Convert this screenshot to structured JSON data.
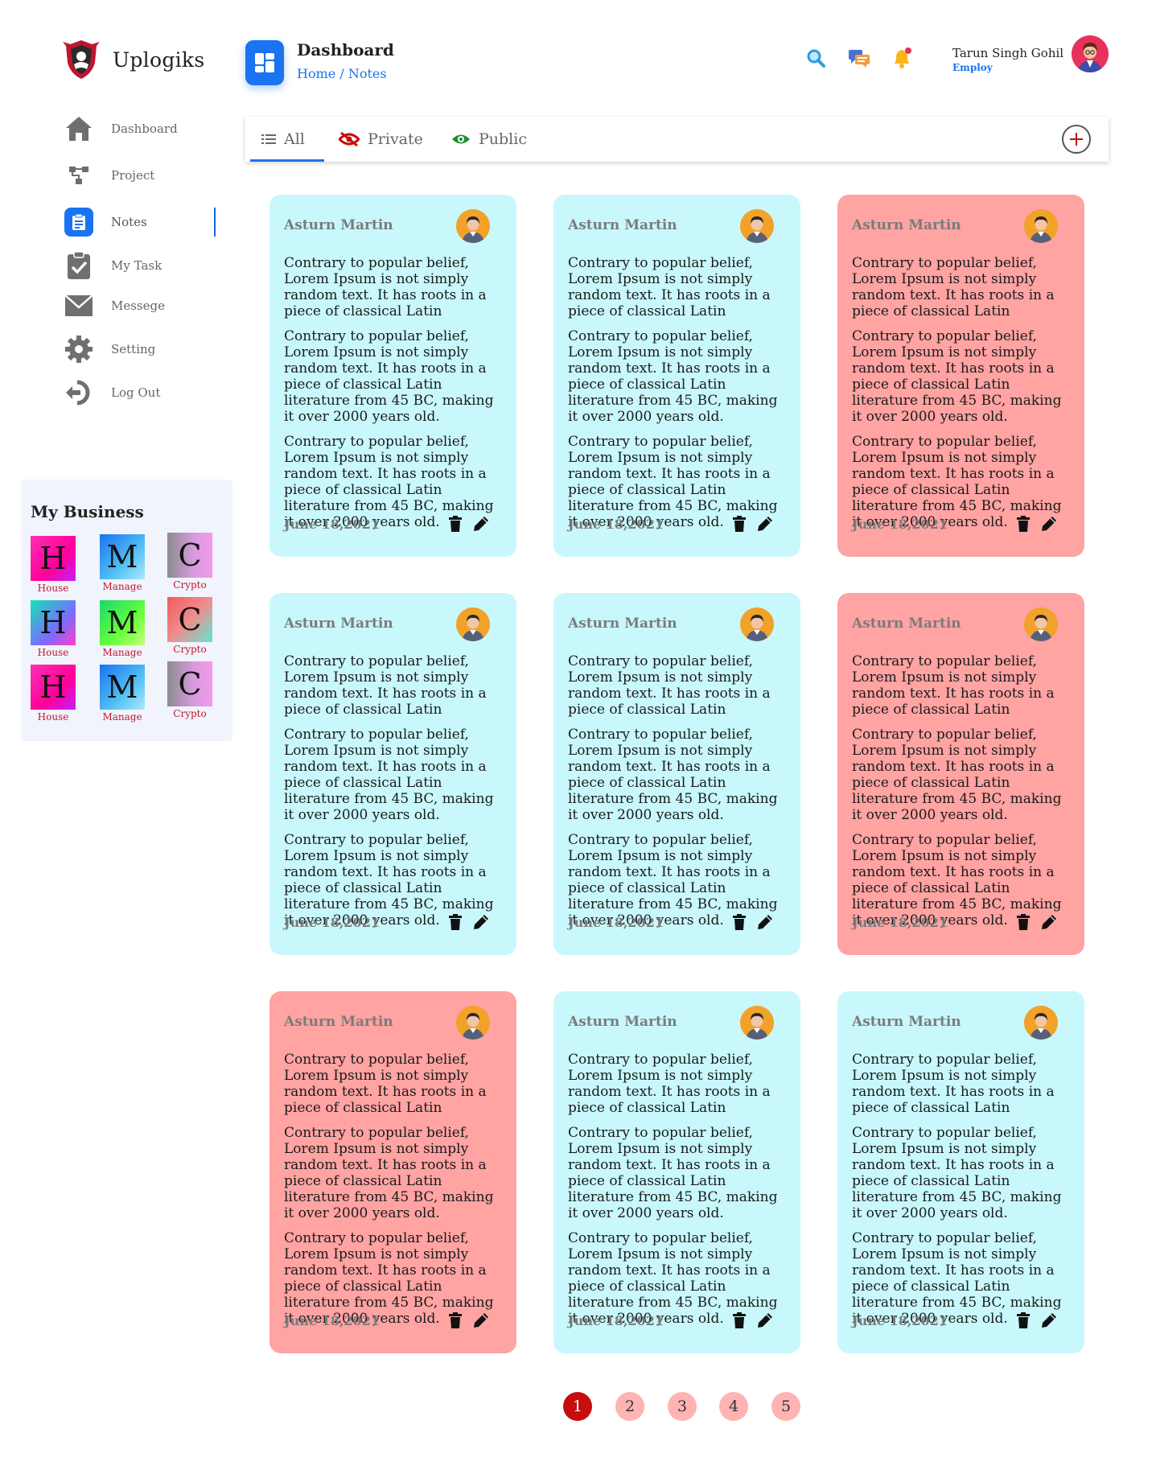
{
  "brand": {
    "name": "Uplogiks",
    "logo_icon": "shield-logo-icon",
    "logo_color": "#c0152f"
  },
  "sidebar": {
    "items": [
      {
        "label": "Dashboard",
        "icon": "home-icon",
        "active": false
      },
      {
        "label": "Project",
        "icon": "hierarchy-icon",
        "active": false
      },
      {
        "label": "Notes",
        "icon": "notes-icon",
        "active": true
      },
      {
        "label": "My Task",
        "icon": "clipboard-check-icon",
        "active": false
      },
      {
        "label": "Messege",
        "icon": "envelope-icon",
        "active": false
      },
      {
        "label": "Setting",
        "icon": "gear-icon",
        "active": false
      },
      {
        "label": "Log Out",
        "icon": "logout-icon",
        "active": false
      }
    ]
  },
  "business": {
    "title": "My Business",
    "tiles": [
      {
        "letter": "H",
        "label": "House"
      },
      {
        "letter": "M",
        "label": "Manage"
      },
      {
        "letter": "C",
        "label": "Crypto"
      },
      {
        "letter": "H",
        "label": "House"
      },
      {
        "letter": "M",
        "label": "Manage"
      },
      {
        "letter": "C",
        "label": "Crypto"
      },
      {
        "letter": "H",
        "label": "House"
      },
      {
        "letter": "M",
        "label": "Manage"
      },
      {
        "letter": "C",
        "label": "Crypto"
      }
    ]
  },
  "header": {
    "title": "Dashboard",
    "breadcrumb": {
      "home": "Home",
      "separator": "/",
      "current": "Notes"
    },
    "user": {
      "name": "Tarun Singh Gohil",
      "role": "Employ"
    }
  },
  "tabs": [
    {
      "label": "All",
      "icon": "list-icon",
      "active": true
    },
    {
      "label": "Private",
      "icon": "eye-off-icon",
      "active": false
    },
    {
      "label": "Public",
      "icon": "eye-icon",
      "active": false
    }
  ],
  "colors": {
    "accent": "#1a73f0",
    "public_card": "#c8f8fc",
    "private_card": "#ffa3a3",
    "page_active": "#c70d0d",
    "page_inactive": "#ffb3b3"
  },
  "notes": [
    {
      "author": "Asturn Martin",
      "visibility": "public",
      "date": "June 18,2021",
      "paragraphs": [
        "Contrary to popular belief, Lorem Ipsum is not simply random text. It has roots in a piece of classical Latin",
        "Contrary to popular belief, Lorem Ipsum is not simply random text. It has roots in a piece of classical Latin literature from 45 BC, making it over 2000 years old.",
        "Contrary to popular belief, Lorem Ipsum is not simply random text. It has roots in a piece of classical Latin literature from 45 BC, making it over 2000 years old."
      ]
    },
    {
      "author": "Asturn Martin",
      "visibility": "public",
      "date": "June 18,2021",
      "paragraphs": [
        "Contrary to popular belief, Lorem Ipsum is not simply random text. It has roots in a piece of classical Latin",
        "Contrary to popular belief, Lorem Ipsum is not simply random text. It has roots in a piece of classical Latin literature from 45 BC, making it over 2000 years old.",
        "Contrary to popular belief, Lorem Ipsum is not simply random text. It has roots in a piece of classical Latin literature from 45 BC, making it over 2000 years old."
      ]
    },
    {
      "author": "Asturn Martin",
      "visibility": "private",
      "date": "June 18,2021",
      "paragraphs": [
        "Contrary to popular belief, Lorem Ipsum is not simply random text. It has roots in a piece of classical Latin",
        "Contrary to popular belief, Lorem Ipsum is not simply random text. It has roots in a piece of classical Latin literature from 45 BC, making it over 2000 years old.",
        "Contrary to popular belief, Lorem Ipsum is not simply random text. It has roots in a piece of classical Latin literature from 45 BC, making it over 2000 years old."
      ]
    },
    {
      "author": "Asturn Martin",
      "visibility": "public",
      "date": "June 18,2021",
      "paragraphs": [
        "Contrary to popular belief, Lorem Ipsum is not simply random text. It has roots in a piece of classical Latin",
        "Contrary to popular belief, Lorem Ipsum is not simply random text. It has roots in a piece of classical Latin literature from 45 BC, making it over 2000 years old.",
        "Contrary to popular belief, Lorem Ipsum is not simply random text. It has roots in a piece of classical Latin literature from 45 BC, making it over 2000 years old."
      ]
    },
    {
      "author": "Asturn Martin",
      "visibility": "public",
      "date": "June 18,2021",
      "paragraphs": [
        "Contrary to popular belief, Lorem Ipsum is not simply random text. It has roots in a piece of classical Latin",
        "Contrary to popular belief, Lorem Ipsum is not simply random text. It has roots in a piece of classical Latin literature from 45 BC, making it over 2000 years old.",
        "Contrary to popular belief, Lorem Ipsum is not simply random text. It has roots in a piece of classical Latin literature from 45 BC, making it over 2000 years old."
      ]
    },
    {
      "author": "Asturn Martin",
      "visibility": "private",
      "date": "June 18,2021",
      "paragraphs": [
        "Contrary to popular belief, Lorem Ipsum is not simply random text. It has roots in a piece of classical Latin",
        "Contrary to popular belief, Lorem Ipsum is not simply random text. It has roots in a piece of classical Latin literature from 45 BC, making it over 2000 years old.",
        "Contrary to popular belief, Lorem Ipsum is not simply random text. It has roots in a piece of classical Latin literature from 45 BC, making it over 2000 years old."
      ]
    },
    {
      "author": "Asturn Martin",
      "visibility": "private",
      "date": "June 18,2021",
      "paragraphs": [
        "Contrary to popular belief, Lorem Ipsum is not simply random text. It has roots in a piece of classical Latin",
        "Contrary to popular belief, Lorem Ipsum is not simply random text. It has roots in a piece of classical Latin literature from 45 BC, making it over 2000 years old.",
        "Contrary to popular belief, Lorem Ipsum is not simply random text. It has roots in a piece of classical Latin literature from 45 BC, making it over 2000 years old."
      ]
    },
    {
      "author": "Asturn Martin",
      "visibility": "public",
      "date": "June 18,2021",
      "paragraphs": [
        "Contrary to popular belief, Lorem Ipsum is not simply random text. It has roots in a piece of classical Latin",
        "Contrary to popular belief, Lorem Ipsum is not simply random text. It has roots in a piece of classical Latin literature from 45 BC, making it over 2000 years old.",
        "Contrary to popular belief, Lorem Ipsum is not simply random text. It has roots in a piece of classical Latin literature from 45 BC, making it over 2000 years old."
      ]
    },
    {
      "author": "Asturn Martin",
      "visibility": "public",
      "date": "June 18,2021",
      "paragraphs": [
        "Contrary to popular belief, Lorem Ipsum is not simply random text. It has roots in a piece of classical Latin",
        "Contrary to popular belief, Lorem Ipsum is not simply random text. It has roots in a piece of classical Latin literature from 45 BC, making it over 2000 years old.",
        "Contrary to popular belief, Lorem Ipsum is not simply random text. It has roots in a piece of classical Latin literature from 45 BC, making it over 2000 years old."
      ]
    }
  ],
  "pagination": {
    "pages": [
      "1",
      "2",
      "3",
      "4",
      "5"
    ],
    "current": "1"
  }
}
